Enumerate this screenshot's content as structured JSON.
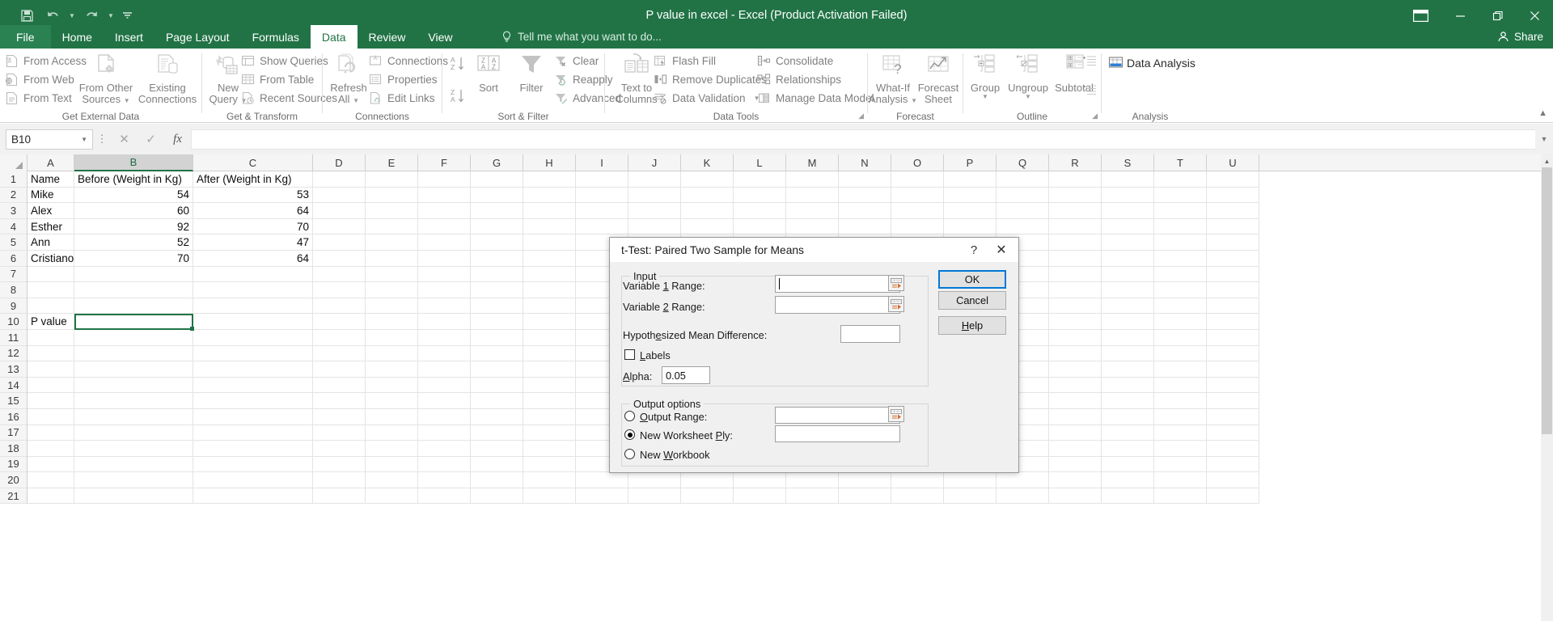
{
  "window": {
    "title": "P value in excel - Excel (Product Activation Failed)",
    "quick_access": [
      {
        "name": "save-icon",
        "label": "Save"
      },
      {
        "name": "undo-icon",
        "label": "Undo"
      },
      {
        "name": "redo-icon",
        "label": "Redo"
      },
      {
        "name": "customize-qat-icon",
        "label": "Customize Quick Access Toolbar"
      }
    ],
    "controls": {
      "ribbon_display": "Ribbon Display Options",
      "minimize": "Minimize",
      "restore": "Restore Down",
      "close": "Close"
    }
  },
  "tabs": [
    {
      "label": "File",
      "active": false,
      "file": true
    },
    {
      "label": "Home",
      "active": false
    },
    {
      "label": "Insert",
      "active": false
    },
    {
      "label": "Page Layout",
      "active": false
    },
    {
      "label": "Formulas",
      "active": false
    },
    {
      "label": "Data",
      "active": true
    },
    {
      "label": "Review",
      "active": false
    },
    {
      "label": "View",
      "active": false
    }
  ],
  "tell_me": "Tell me what you want to do...",
  "share": "Share",
  "ribbon": {
    "groups": [
      {
        "name": "get-external-data",
        "label": "Get External Data",
        "small_items": [
          {
            "label": "From Access",
            "icon": "from-access-icon"
          },
          {
            "label": "From Web",
            "icon": "from-web-icon"
          },
          {
            "label": "From Text",
            "icon": "from-text-icon"
          }
        ],
        "big_items": [
          {
            "label1": "From Other",
            "label2": "Sources",
            "icon": "from-other-sources-icon",
            "caret": true
          },
          {
            "label1": "Existing",
            "label2": "Connections",
            "icon": "existing-connections-icon",
            "caret": false
          }
        ]
      },
      {
        "name": "get-and-transform",
        "label": "Get & Transform",
        "big_items": [
          {
            "label1": "New",
            "label2": "Query",
            "icon": "new-query-icon",
            "caret": true
          }
        ],
        "small_items": [
          {
            "label": "Show Queries",
            "icon": "show-queries-icon"
          },
          {
            "label": "From Table",
            "icon": "from-table-icon"
          },
          {
            "label": "Recent Sources",
            "icon": "recent-sources-icon"
          }
        ]
      },
      {
        "name": "connections",
        "label": "Connections",
        "big_items": [
          {
            "label1": "Refresh",
            "label2": "All",
            "icon": "refresh-all-icon",
            "caret": true
          }
        ],
        "small_items": [
          {
            "label": "Connections",
            "icon": "connections-icon"
          },
          {
            "label": "Properties",
            "icon": "properties-icon"
          },
          {
            "label": "Edit Links",
            "icon": "edit-links-icon"
          }
        ]
      },
      {
        "name": "sort-and-filter",
        "label": "Sort & Filter",
        "big_items": [
          {
            "label1": "Sort",
            "label2": "",
            "icon": "sort-icon",
            "caret": false
          },
          {
            "label1": "Filter",
            "label2": "",
            "icon": "filter-icon",
            "caret": false
          }
        ],
        "small_items": [
          {
            "label": "Clear",
            "icon": "clear-filter-icon"
          },
          {
            "label": "Reapply",
            "icon": "reapply-icon"
          },
          {
            "label": "Advanced",
            "icon": "advanced-filter-icon"
          }
        ],
        "mini_items": [
          {
            "label": "Sort A to Z",
            "icon": "sort-az-icon"
          },
          {
            "label": "Sort Z to A",
            "icon": "sort-za-icon"
          }
        ]
      },
      {
        "name": "data-tools",
        "label": "Data Tools",
        "big_items": [
          {
            "label1": "Text to",
            "label2": "Columns",
            "icon": "text-to-columns-icon",
            "caret": false
          }
        ],
        "small_items": [
          {
            "label": "Flash Fill",
            "icon": "flash-fill-icon"
          },
          {
            "label": "Remove Duplicates",
            "icon": "remove-duplicates-icon"
          },
          {
            "label": "Data Validation",
            "icon": "data-validation-icon",
            "caret": true
          },
          {
            "label": "Consolidate",
            "icon": "consolidate-icon"
          },
          {
            "label": "Relationships",
            "icon": "relationships-icon"
          },
          {
            "label": "Manage Data Model",
            "icon": "manage-data-model-icon"
          }
        ]
      },
      {
        "name": "forecast",
        "label": "Forecast",
        "big_items": [
          {
            "label1": "What-If",
            "label2": "Analysis",
            "icon": "what-if-analysis-icon",
            "caret": true
          },
          {
            "label1": "Forecast",
            "label2": "Sheet",
            "icon": "forecast-sheet-icon",
            "caret": false
          }
        ]
      },
      {
        "name": "outline",
        "label": "Outline",
        "big_items": [
          {
            "label1": "Group",
            "label2": "",
            "icon": "group-icon",
            "caret": true
          },
          {
            "label1": "Ungroup",
            "label2": "",
            "icon": "ungroup-icon",
            "caret": true
          },
          {
            "label1": "Subtotal",
            "label2": "",
            "icon": "subtotal-icon",
            "caret": false
          }
        ],
        "mini_items": [
          {
            "label": "Show Detail",
            "icon": "show-detail-icon"
          },
          {
            "label": "Hide Detail",
            "icon": "hide-detail-icon"
          }
        ]
      },
      {
        "name": "analysis",
        "label": "Analysis",
        "small_items": [
          {
            "label": "Data Analysis",
            "icon": "data-analysis-icon"
          }
        ]
      }
    ],
    "collapse": "Collapse the Ribbon"
  },
  "formula_bar": {
    "name_box": "B10",
    "cancel": "Cancel",
    "enter": "Enter",
    "insert_function": "fx",
    "value": "",
    "expand": "Expand Formula Bar"
  },
  "grid": {
    "columns": [
      "A",
      "B",
      "C",
      "D",
      "E",
      "F",
      "G",
      "H",
      "I",
      "J",
      "K",
      "L",
      "M",
      "N",
      "O",
      "P",
      "Q",
      "R",
      "S",
      "T",
      "U"
    ],
    "selected_column": "B",
    "rows": [
      "1",
      "2",
      "3",
      "4",
      "5",
      "6",
      "7",
      "8",
      "9",
      "10",
      "11",
      "12",
      "13",
      "14",
      "15",
      "16",
      "17",
      "18",
      "19",
      "20",
      "21"
    ],
    "data": [
      {
        "row": "1",
        "A": "Name",
        "B": "Before (Weight in Kg)",
        "C": "After (Weight in Kg)"
      },
      {
        "row": "2",
        "A": "Mike",
        "B": "54",
        "C": "53"
      },
      {
        "row": "3",
        "A": "Alex",
        "B": "60",
        "C": "64"
      },
      {
        "row": "4",
        "A": "Esther",
        "B": "92",
        "C": "70"
      },
      {
        "row": "5",
        "A": "Ann",
        "B": "52",
        "C": "47"
      },
      {
        "row": "6",
        "A": "Cristiano",
        "B": "70",
        "C": "64"
      },
      {
        "row": "7",
        "A": "",
        "B": "",
        "C": ""
      },
      {
        "row": "8",
        "A": "",
        "B": "",
        "C": ""
      },
      {
        "row": "9",
        "A": "",
        "B": "",
        "C": ""
      },
      {
        "row": "10",
        "A": "P value",
        "B": "",
        "C": ""
      },
      {
        "row": "11",
        "A": "",
        "B": "",
        "C": ""
      },
      {
        "row": "12",
        "A": "",
        "B": "",
        "C": ""
      },
      {
        "row": "13",
        "A": "",
        "B": "",
        "C": ""
      },
      {
        "row": "14",
        "A": "",
        "B": "",
        "C": ""
      },
      {
        "row": "15",
        "A": "",
        "B": "",
        "C": ""
      },
      {
        "row": "16",
        "A": "",
        "B": "",
        "C": ""
      },
      {
        "row": "17",
        "A": "",
        "B": "",
        "C": ""
      },
      {
        "row": "18",
        "A": "",
        "B": "",
        "C": ""
      },
      {
        "row": "19",
        "A": "",
        "B": "",
        "C": ""
      },
      {
        "row": "20",
        "A": "",
        "B": "",
        "C": ""
      },
      {
        "row": "21",
        "A": "",
        "B": "",
        "C": ""
      }
    ],
    "active_cell": "B10"
  },
  "dialog": {
    "title": "t-Test: Paired Two Sample for Means",
    "help_btn": "?",
    "close_btn": "✕",
    "input_group": {
      "legend": "Input",
      "variable1_label_pre": "Variable ",
      "variable1_label_key": "1",
      "variable1_label_post": " Range:",
      "variable1_value": "",
      "variable2_label_pre": "Variable ",
      "variable2_label_key": "2",
      "variable2_label_post": " Range:",
      "variable2_value": "",
      "hypothesized_label_pre": "Hypoth",
      "hypothesized_label_key": "e",
      "hypothesized_label_post": "sized Mean Difference:",
      "hypothesized_value": "",
      "labels_checkbox_pre": "",
      "labels_checkbox_key": "L",
      "labels_checkbox_post": "abels",
      "labels_checked": false,
      "alpha_label_key": "A",
      "alpha_label_post": "lpha:",
      "alpha_value": "0.05"
    },
    "output_group": {
      "legend": "Output options",
      "output_range_key": "O",
      "output_range_post": "utput Range:",
      "output_range_value": "",
      "output_range_selected": false,
      "new_worksheet_pre": "New Worksheet ",
      "new_worksheet_key": "P",
      "new_worksheet_post": "ly:",
      "new_worksheet_value": "",
      "new_worksheet_selected": true,
      "new_workbook_pre": "New ",
      "new_workbook_key": "W",
      "new_workbook_post": "orkbook",
      "new_workbook_selected": false
    },
    "buttons": {
      "ok": "OK",
      "cancel": "Cancel",
      "help_key": "H",
      "help_post": "elp"
    },
    "range_select_icon": "range-select-icon"
  },
  "colors": {
    "brand_green": "#217346",
    "accent_blue": "#0078d7",
    "ribbon_gray": "#7f7f7f"
  }
}
